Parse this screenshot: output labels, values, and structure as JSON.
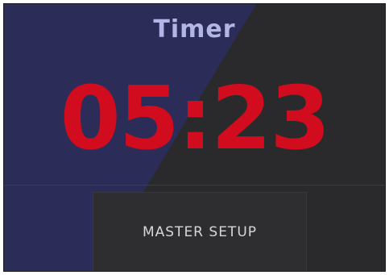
{
  "timer": {
    "title": "Timer",
    "time": "05:23"
  },
  "controls": {
    "master_setup_label": "MASTER SETUP"
  },
  "colors": {
    "background": "#2a2a2c",
    "accent_panel": "#2b2d58",
    "time_color": "#d10c1f",
    "title_color": "#b3b6e4"
  }
}
